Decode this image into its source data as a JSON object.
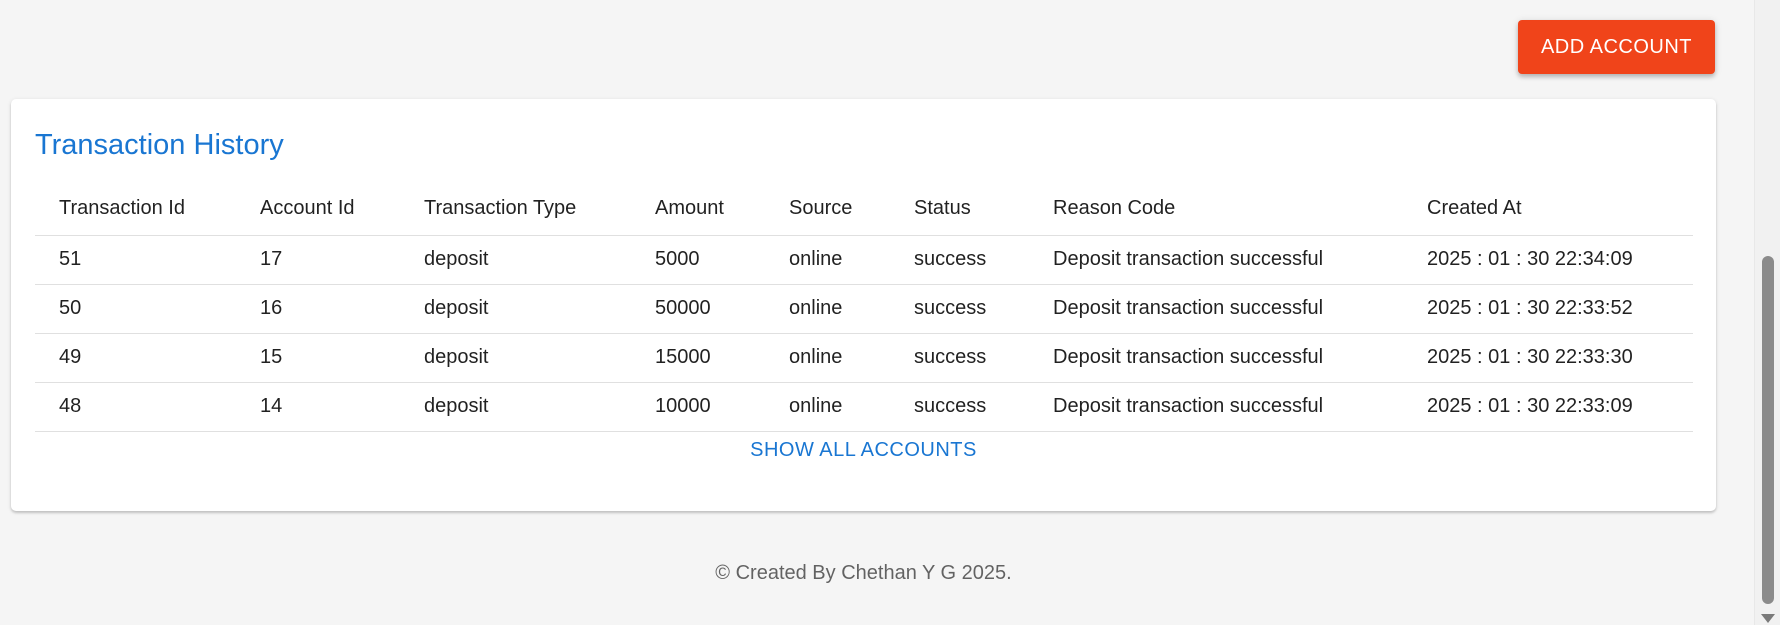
{
  "toolbar": {
    "add_account_label": "ADD ACCOUNT"
  },
  "card": {
    "title": "Transaction History",
    "columns": [
      "Transaction Id",
      "Account Id",
      "Transaction Type",
      "Amount",
      "Source",
      "Status",
      "Reason Code",
      "Created At"
    ],
    "rows": [
      [
        "51",
        "17",
        "deposit",
        "5000",
        "online",
        "success",
        "Deposit transaction successful",
        "2025 : 01 : 30 22:34:09"
      ],
      [
        "50",
        "16",
        "deposit",
        "50000",
        "online",
        "success",
        "Deposit transaction successful",
        "2025 : 01 : 30 22:33:52"
      ],
      [
        "49",
        "15",
        "deposit",
        "15000",
        "online",
        "success",
        "Deposit transaction successful",
        "2025 : 01 : 30 22:33:30"
      ],
      [
        "48",
        "14",
        "deposit",
        "10000",
        "online",
        "success",
        "Deposit transaction successful",
        "2025 : 01 : 30 22:33:09"
      ]
    ],
    "show_all_label": "SHOW ALL ACCOUNTS"
  },
  "footer": {
    "text": "© Created By Chethan Y G 2025."
  },
  "colors": {
    "primary": "#1976d2",
    "accent": "#f0441a",
    "background": "#f5f5f5"
  }
}
